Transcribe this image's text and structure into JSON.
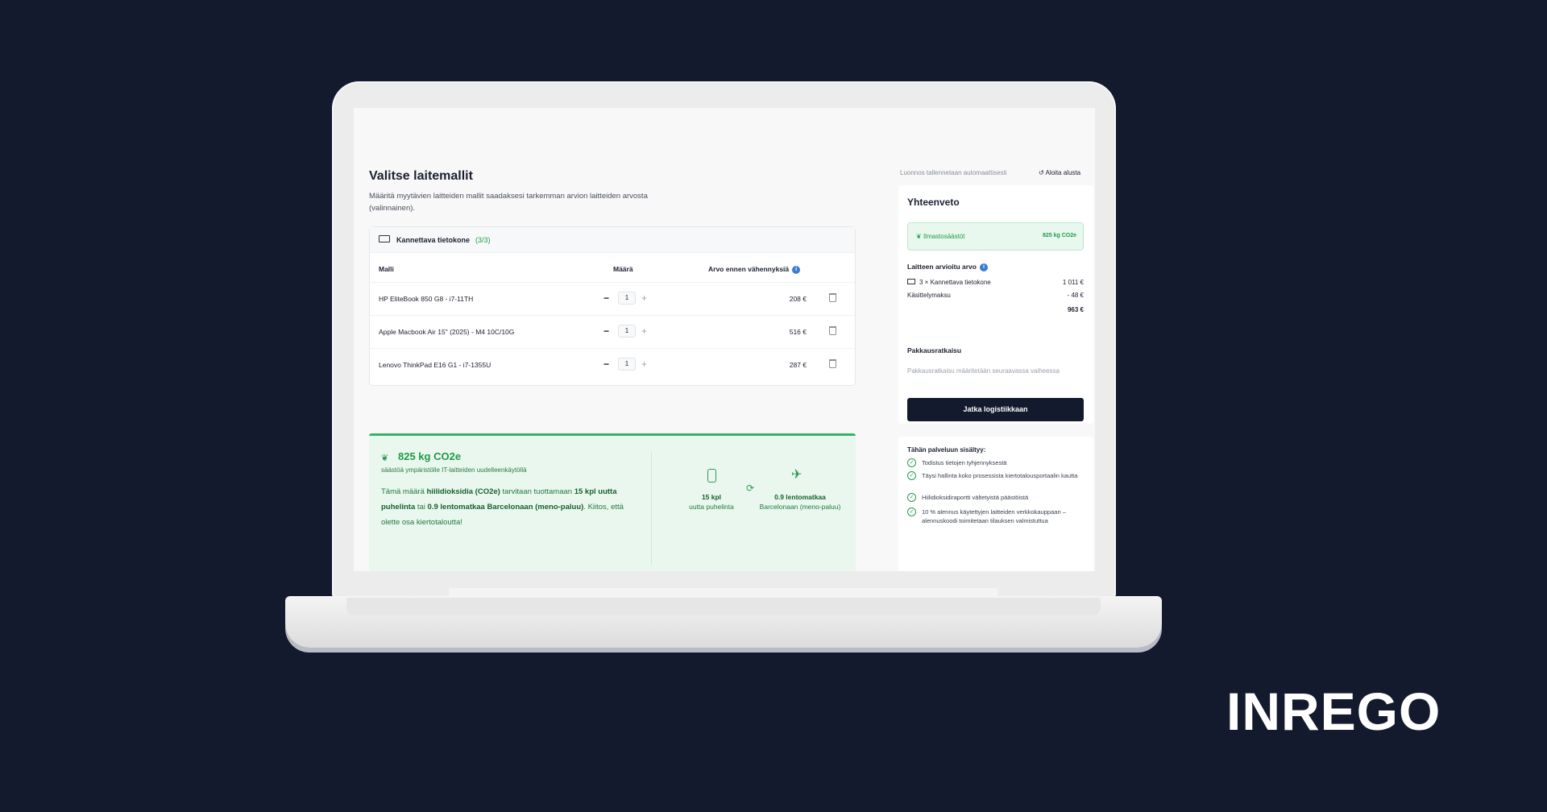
{
  "brand": "INREGO",
  "page": {
    "title": "Valitse laitemallit",
    "subtitle": "Määritä myytävien laitteiden mallit saadaksesi tarkemman arvion laitteiden arvosta (valinnainen)."
  },
  "devices": {
    "category": "Kannettava tietokone",
    "count": "(3/3)",
    "columns": {
      "model": "Malli",
      "quantity": "Määrä",
      "value": "Arvo ennen vähennyksiä"
    },
    "rows": [
      {
        "model": "HP EliteBook 850 G8 - i7-11TH",
        "quantity": "1",
        "price": "208 €"
      },
      {
        "model": "Apple Macbook Air 15\" (2025) - M4 10C/10G",
        "quantity": "1",
        "price": "516 €"
      },
      {
        "model": "Lenovo ThinkPad E16 G1 - i7-1355U",
        "quantity": "1",
        "price": "287 €"
      }
    ]
  },
  "eco": {
    "amount": "825 kg CO2e",
    "sub": "säästöä ympäristölle IT-laitteiden uudelleenkäytöllä",
    "text_a": "Tämä määrä ",
    "text_b": "hiilidioksidia (CO2e)",
    "text_c": " tarvitaan tuottamaan ",
    "text_d": "15 kpl uutta puhelinta",
    "text_e": " tai ",
    "text_f": "0.9 lentomatkaa Barcelonaan (meno-paluu)",
    "text_g": ". Kiitos, että olette osa kiertotaloutta!",
    "stat_phones_value": "15 kpl",
    "stat_phones_label": "uutta puhelinta",
    "stat_flights_value": "0.9 lentomatkaa",
    "stat_flights_label": "Barcelonaan (meno-paluu)"
  },
  "header": {
    "notice": "Luonnos tallennetaan automaattisesti",
    "reset": "Aloita alusta"
  },
  "summary": {
    "title": "Yhteenveto",
    "climate_label": "Ilmastosäästöt",
    "climate_value": "825 kg CO2e",
    "value_label": "Laitteen arvioitu arvo",
    "line_item": "3 × Kannettava tietokone",
    "line_value": "1 011 €",
    "fee_label": "Käsittelymaksu",
    "fee_value": "- 48 €",
    "total": "963 €",
    "packaging_label": "Pakkausratkaisu",
    "packaging_note": "Pakkausratkaisu määritetään seuraavassa vaiheessa",
    "cta": "Jatka logistiikkaan"
  },
  "included": {
    "title": "Tähän palveluun sisältyy:",
    "items": [
      "Todistus tietojen tyhjennyksestä",
      "Täysi hallinta koko prosessista kiertotalousportaalin kautta",
      "Hiilidioksidiraportti vältetyistä päästöistä",
      "10 % alennus käytettyjen laitteiden verkkokauppaan – alennuskoodi toimitetaan tilauksen valmistuttua"
    ]
  }
}
